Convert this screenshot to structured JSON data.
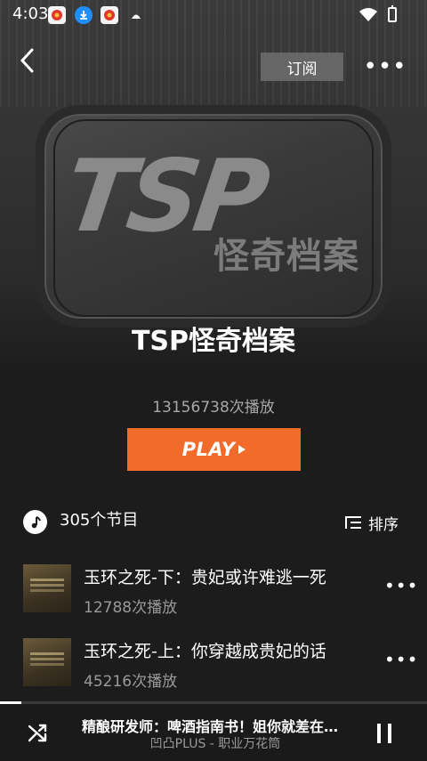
{
  "status_bar": {
    "time": "4:03"
  },
  "hero": {
    "logo_text": "TSP",
    "logo_sub": "怪奇档案"
  },
  "header": {
    "subscribe_label": "订阅",
    "more_label": "•••"
  },
  "album": {
    "title": "TSP怪奇档案",
    "play_count": "13156738次播放",
    "play_label": "PLAY"
  },
  "episodes": {
    "count_label": "305个节目",
    "sort_label": "排序",
    "items": [
      {
        "title": "玉环之死-下：贵妃或许难逃一死",
        "plays": "12788次播放"
      },
      {
        "title": "玉环之死-上：你穿越成贵妃的话",
        "plays": "45216次播放"
      }
    ]
  },
  "player": {
    "title": "精酿研发师：啤酒指南书！姐你就差在哪了",
    "subtitle": "凹凸PLUS - 职业万花筒",
    "progress": 0.05
  },
  "colors": {
    "accent": "#f26b2a",
    "background": "#1c1c1c"
  }
}
